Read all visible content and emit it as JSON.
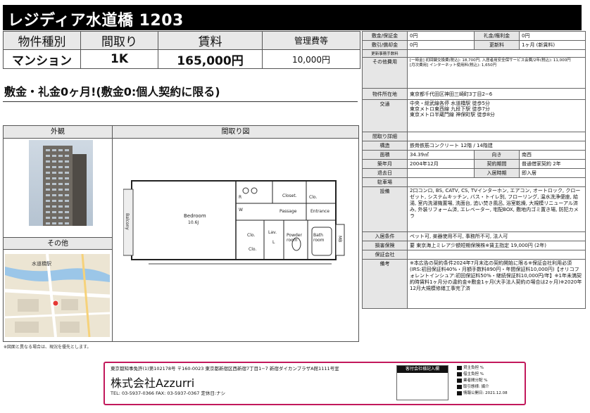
{
  "title": "レジディア水道橋 1203",
  "summary": {
    "headers": [
      "物件種別",
      "間取り",
      "賃料",
      "管理費等"
    ],
    "values": [
      "マンション",
      "1K",
      "165,000円",
      "10,000円"
    ]
  },
  "catch_copy": "敷金・礼金0ヶ月!(敷金0:個人契約に限る)",
  "panels": {
    "exterior": "外観",
    "floorplan": "間取り図",
    "other": "その他"
  },
  "floorplan_labels": {
    "bedroom": "Bedroom",
    "bedroom_size": "10.6J",
    "balcony": "Balcony",
    "closet": "Closet.",
    "clo1": "Clo.",
    "clo2": "Clo.",
    "clo3": "Clo.",
    "passage": "Passage",
    "entrance": "Entrance",
    "lav": "Lav.",
    "l": "L",
    "powder": "Powder room",
    "bath": "Bath room",
    "mb": "MB",
    "r": "R",
    "w": "W"
  },
  "map_labels": {
    "station": "水道橋駅"
  },
  "figure_note": "※図面と異なる場合は、現況を優先とします。",
  "details": {
    "deposit_label": "敷金/保証金",
    "deposit_value": "0円",
    "key_money_label": "礼金/権利金",
    "key_money_value": "0円",
    "amortization_label": "敷引/償却金",
    "amortization_value": "0円",
    "renewal_label": "更新料",
    "renewal_value": "1ヶ月 (新賃料)",
    "renewal_admin_label": "更新事務手数料",
    "renewal_admin_value": "",
    "other_costs_label": "その他費用",
    "other_costs_line1": "[一時金] 初回鍵交換費(税込): 18,700円, 入居者用安全保サービス会費/2年(税込): 11,000円",
    "other_costs_line2": "[月次費用] インターネット使用料(税込): 1,650円",
    "location_label": "物件所在地",
    "location_value": "東京都千代田区神田三崎町3丁目2−6",
    "transport_label": "交通",
    "transport_lines": [
      "中央・総武線各停 水道橋駅 徒歩5分",
      "東京メトロ東西線 九段下駅 徒歩7分",
      "東京メトロ半蔵門線 神保町駅 徒歩8分"
    ],
    "layout_detail_label": "間取り詳細",
    "layout_detail_value": "",
    "structure_label": "構造",
    "structure_value": "鉄骨鉄筋コンクリート 12階 / 14階建",
    "area_label": "面積",
    "area_value": "34.39㎡",
    "orientation_label": "向き",
    "orientation_value": "南西",
    "built_label": "築年月",
    "built_value": "2004年12月",
    "contract_label": "契約期間",
    "contract_value": "普通借家契約 2年",
    "vacate_label": "退去日",
    "vacate_value": "",
    "movein_label": "入居時期",
    "movein_value": "即入居",
    "parking_label": "駐車場",
    "parking_value": "",
    "equipment_label": "設備",
    "equipment_value": "2口コンロ, BS, CATV, CS, TVインターホン, エアコン, オートロック, クローゼット, システムキッチン, バス・トイレ別, フローリング, 温水洗浄便座, 給湯, 室内洗濯機置場, 洗面台, 追い焚き風呂, 浴室乾燥, 大規模リニューアル済み, 外装リフォーム済, エレベーター, 宅配BOX, 敷地内ゴミ置き場, 防犯カメラ",
    "conditions_label": "入居条件",
    "conditions_value": "ペット可, 楽器使用不可, 事務所不可, 法人可",
    "insurance_label": "損害保険",
    "insurance_value": "要 東京海上ミレア少額短期保険株※賃主指定 19,000円 (2年)",
    "guarantor_label": "保証会社",
    "guarantor_value": "",
    "remarks_label": "備考",
    "remarks_value": "※本広告の契約条件2024年7月末迄の契約開始に限る※保証会社利用必須(IRS:初回保証料40%・月額手数料890円・年間保証料10,000円)【オリコフォレントインシュア:初回保証料50%・継続保証料10,000円/年】※1年未満契約時賃料1ヶ月分の違約金※敷金1ヶ月(大手法人契約の場合は2ヶ月)※2020年12月大規模修繕工事完了済"
  },
  "footer": {
    "license": "東京都知事免許(1)第102178号 〒160-0023 東京都新宿区西新宿7丁目1−7 新宿ダイカンプラザA館1111号室",
    "company": "株式会社Azzurri",
    "contact": "TEL: 03-5937-0366  FAX: 03-5937-0367  定休日:ナシ",
    "stamp_header": "客付会社様記入欄",
    "fee_lines": [
      "貸主負担  %",
      "借主負担  %",
      "業者間分配  %"
    ],
    "transaction_type": "取引態様: 媒介",
    "info_date": "情報公開日: 2021.12.08"
  }
}
